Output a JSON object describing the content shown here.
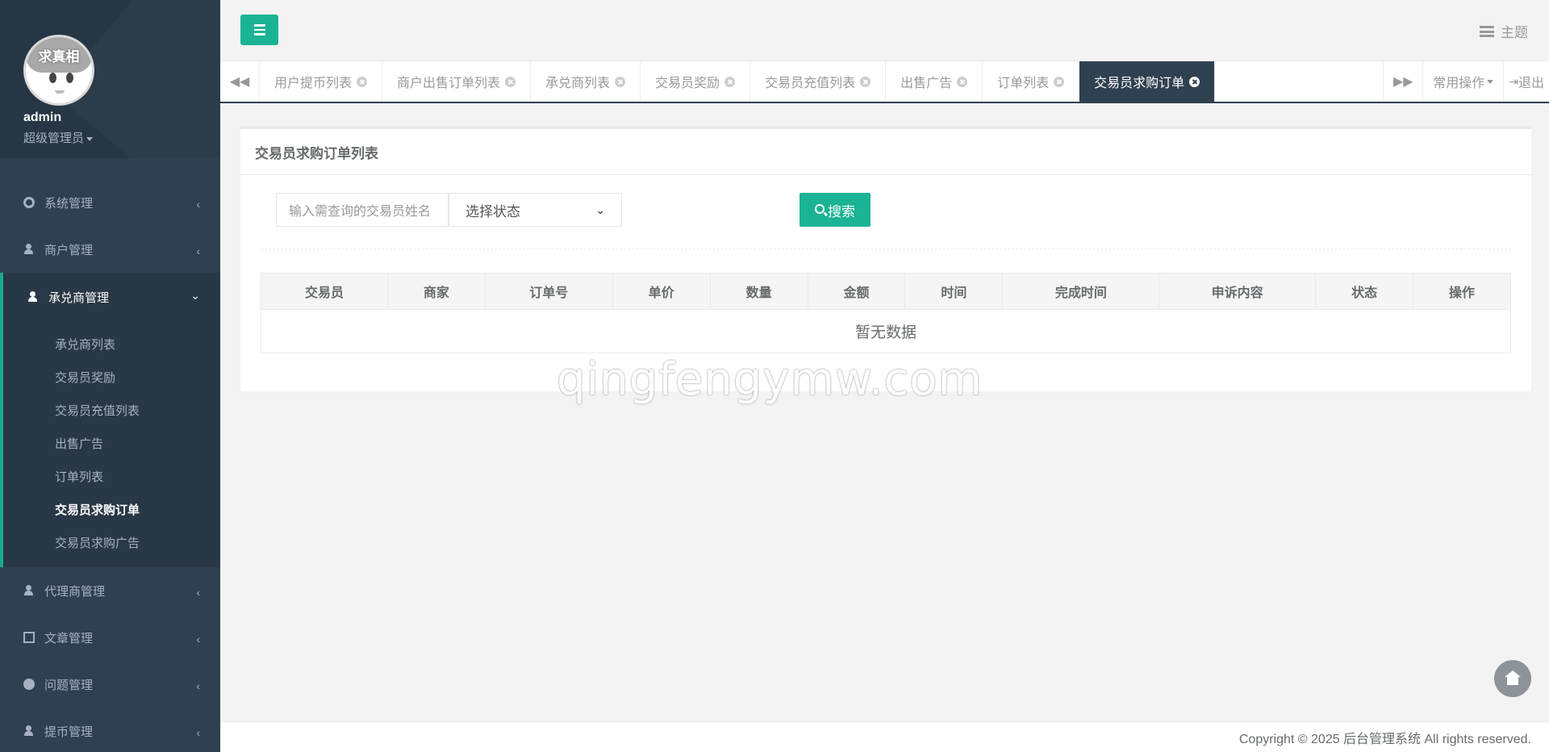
{
  "sidebar": {
    "avatar_text": "求真相",
    "username": "admin",
    "role": "超级管理员",
    "menu": [
      {
        "label": "系统管理",
        "icon": "gear-icon"
      },
      {
        "label": "商户管理",
        "icon": "user-icon"
      },
      {
        "label": "承兑商管理",
        "icon": "user-icon"
      },
      {
        "label": "代理商管理",
        "icon": "user-icon"
      },
      {
        "label": "文章管理",
        "icon": "document-icon"
      },
      {
        "label": "问题管理",
        "icon": "chat-icon"
      },
      {
        "label": "提币管理",
        "icon": "user-icon"
      }
    ],
    "submenu": [
      "承兑商列表",
      "交易员奖励",
      "交易员充值列表",
      "出售广告",
      "订单列表",
      "交易员求购订单",
      "交易员求购广告"
    ]
  },
  "topbar": {
    "theme_label": "主题"
  },
  "tabs": [
    "用户提币列表",
    "商户出售订单列表",
    "承兑商列表",
    "交易员奖励",
    "交易员充值列表",
    "出售广告",
    "订单列表",
    "交易员求购订单"
  ],
  "tabbar": {
    "common_ops": "常用操作",
    "logout": "退出"
  },
  "content": {
    "title": "交易员求购订单列表",
    "search_placeholder": "输入需查询的交易员姓名",
    "status_select": "选择状态",
    "search_button": "搜索",
    "columns": [
      "交易员",
      "商家",
      "订单号",
      "单价",
      "数量",
      "金额",
      "时间",
      "完成时间",
      "申诉内容",
      "状态",
      "操作"
    ],
    "empty_text": "暂无数据"
  },
  "watermark": "qingfengymw.com",
  "footer": "Copyright © 2025 后台管理系统 All rights reserved.",
  "colors": {
    "sidebar": "#2f4050",
    "accent": "#1ab394"
  }
}
